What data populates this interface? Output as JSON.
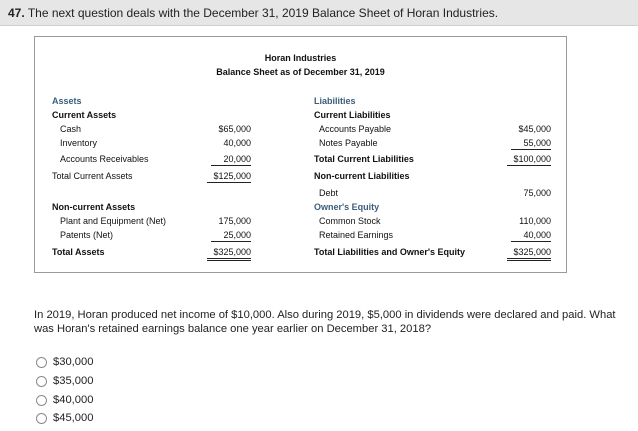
{
  "question": {
    "number": "47.",
    "prompt": "The next question deals with the December 31, 2019 Balance Sheet of Horan Industries.",
    "body": "In 2019, Horan produced net income of $10,000. Also during 2019, $5,000 in dividends were declared and paid. What was Horan's retained earnings balance one year earlier on December 31, 2018?",
    "options": [
      "$30,000",
      "$35,000",
      "$40,000",
      "$45,000"
    ]
  },
  "balance_sheet": {
    "company": "Horan Industries",
    "subtitle": "Balance Sheet as of December 31, 2019",
    "assets": {
      "heading": "Assets",
      "current_heading": "Current Assets",
      "cash_label": "Cash",
      "cash_value": "$65,000",
      "inventory_label": "Inventory",
      "inventory_value": "40,000",
      "ar_label": "Accounts Receivables",
      "ar_value": "20,000",
      "total_current_label": "Total Current Assets",
      "total_current_value": "$125,000",
      "noncurrent_heading": "Non-current Assets",
      "ppe_label": "Plant and Equipment (Net)",
      "ppe_value": "175,000",
      "patents_label": "Patents (Net)",
      "patents_value": "25,000",
      "total_label": "Total Assets",
      "total_value": "$325,000"
    },
    "liabilities": {
      "heading": "Liabilities",
      "current_heading": "Current Liabilities",
      "ap_label": "Accounts Payable",
      "ap_value": "$45,000",
      "np_label": "Notes Payable",
      "np_value": "55,000",
      "total_current_label": "Total Current Liabilities",
      "total_current_value": "$100,000",
      "noncurrent_heading": "Non-current Liabilities",
      "debt_label": "Debt",
      "debt_value": "75,000"
    },
    "equity": {
      "heading": "Owner's Equity",
      "cs_label": "Common Stock",
      "cs_value": "110,000",
      "re_label": "Retained Earnings",
      "re_value": "40,000",
      "total_label": "Total Liabilities and Owner's Equity",
      "total_value": "$325,000"
    }
  }
}
